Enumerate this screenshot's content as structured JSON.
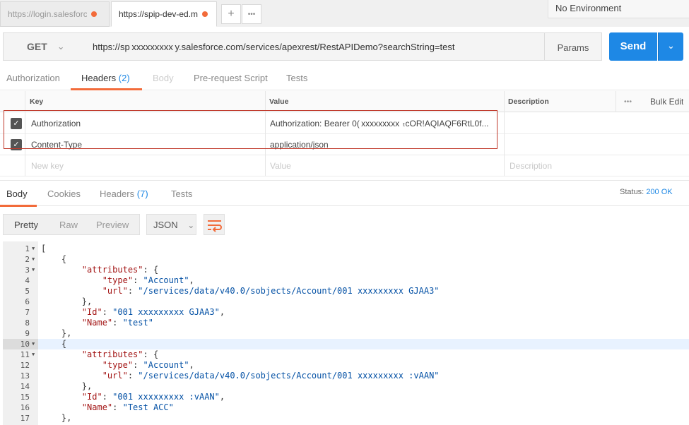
{
  "tabs": [
    {
      "label": "https://login.salesforc",
      "active": false
    },
    {
      "label": "https://spip-dev-ed.m",
      "active": true
    }
  ],
  "tab_actions": {
    "add": "+",
    "more": "•••"
  },
  "environment": "No Environment",
  "request": {
    "method": "GET",
    "url": "https://sp xxxxxxxxx y.salesforce.com/services/apexrest/RestAPIDemo?searchString=test",
    "params_label": "Params",
    "send_label": "Send"
  },
  "request_tabs": [
    {
      "label": "Authorization"
    },
    {
      "label": "Headers",
      "count": "(2)"
    },
    {
      "label": "Body"
    },
    {
      "label": "Pre-request Script"
    },
    {
      "label": "Tests"
    }
  ],
  "headers_table": {
    "columns": {
      "key": "Key",
      "value": "Value",
      "description": "Description",
      "more": "•••",
      "bulk_edit": "Bulk Edit"
    },
    "rows": [
      {
        "key": "Authorization",
        "value": "Authorization: Bearer 0( xxxxxxxxx  ₜcOR!AQIAQF6RtL0f...",
        "checked": true
      },
      {
        "key": "Content-Type",
        "value": "application/json",
        "checked": true
      }
    ],
    "placeholder": {
      "key": "New key",
      "value": "Value",
      "description": "Description"
    }
  },
  "response_tabs": [
    {
      "label": "Body"
    },
    {
      "label": "Cookies"
    },
    {
      "label": "Headers",
      "count": "(7)"
    },
    {
      "label": "Tests"
    }
  ],
  "status": {
    "label": "Status:",
    "value": "200 OK"
  },
  "view_modes": [
    "Pretty",
    "Raw",
    "Preview"
  ],
  "format": "JSON",
  "code_lines": [
    {
      "n": "1",
      "fold": true,
      "text": "["
    },
    {
      "n": "2",
      "fold": true,
      "text": "    {"
    },
    {
      "n": "3",
      "fold": true,
      "text": "        \"attributes\": {"
    },
    {
      "n": "4",
      "fold": false,
      "text": "            \"type\": \"Account\","
    },
    {
      "n": "5",
      "fold": false,
      "text": "            \"url\": \"/services/data/v40.0/sobjects/Account/001 xxxxxxxxx GJAA3\""
    },
    {
      "n": "6",
      "fold": false,
      "text": "        },"
    },
    {
      "n": "7",
      "fold": false,
      "text": "        \"Id\": \"001 xxxxxxxxx GJAA3\","
    },
    {
      "n": "8",
      "fold": false,
      "text": "        \"Name\": \"test\""
    },
    {
      "n": "9",
      "fold": false,
      "text": "    },"
    },
    {
      "n": "10",
      "fold": true,
      "text": "    {"
    },
    {
      "n": "11",
      "fold": true,
      "text": "        \"attributes\": {"
    },
    {
      "n": "12",
      "fold": false,
      "text": "            \"type\": \"Account\","
    },
    {
      "n": "13",
      "fold": false,
      "text": "            \"url\": \"/services/data/v40.0/sobjects/Account/001 xxxxxxxxx :vAAN\""
    },
    {
      "n": "14",
      "fold": false,
      "text": "        },"
    },
    {
      "n": "15",
      "fold": false,
      "text": "        \"Id\": \"001 xxxxxxxxx :vAAN\","
    },
    {
      "n": "16",
      "fold": false,
      "text": "        \"Name\": \"Test ACC\""
    },
    {
      "n": "17",
      "fold": false,
      "text": "    },"
    }
  ],
  "colors": {
    "accent": "#f26b3a",
    "primary": "#1e88e5",
    "annotation": "#c0392b"
  }
}
